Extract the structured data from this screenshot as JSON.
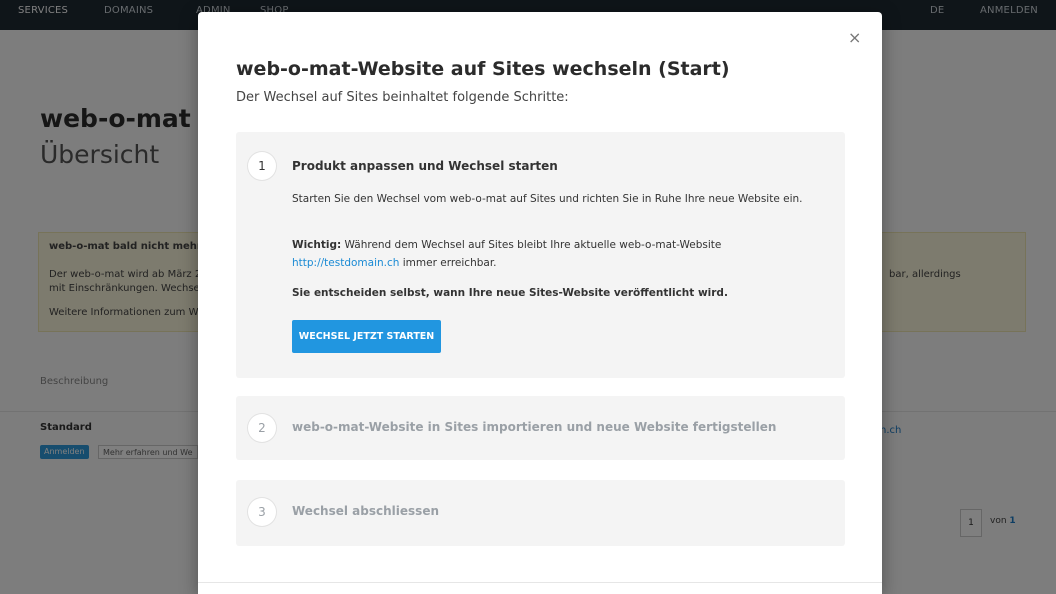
{
  "topbar": {
    "services": "SERVICES",
    "domains": "DOMAINS",
    "admin": "ADMIN",
    "shop": "SHOP",
    "user": "",
    "lang": "DE",
    "login": "Anmelden"
  },
  "page": {
    "title": "web-o-mat",
    "subtitle": "Übersicht",
    "notice_title": "web-o-mat bald nicht mehr",
    "notice_line1": "Der web-o-mat wird ab März 2",
    "notice_line2": "mit Einschränkungen. Wechse",
    "notice_line3": "Weitere Informationen zum W",
    "notice_right": "bar, allerdings",
    "beschreibung": "Beschreibung",
    "standard": "Standard",
    "anmelden_btn": "Anmelden",
    "mehr_btn": "Mehr erfahren und We",
    "domain_fragment": "n.ch",
    "pager_current": "1",
    "pager_von": "von",
    "pager_total": "1"
  },
  "modal": {
    "title": "web-o-mat-Website auf Sites wechseln (Start)",
    "subtitle": "Der Wechsel auf Sites beinhaltet folgende Schritte:",
    "close_label": "×",
    "step1": {
      "number": "1",
      "title": "Produkt anpassen und Wechsel starten",
      "para1": "Starten Sie den Wechsel vom web-o-mat auf Sites und richten Sie in Ruhe Ihre neue Website ein.",
      "para2_bold": "Wichtig:",
      "para2_text": " Während dem Wechsel auf Sites bleibt Ihre aktuelle web-o-mat-Website ",
      "para2_link": "http://testdomain.ch",
      "para2_end": " immer erreichbar.",
      "para3": "Sie entscheiden selbst, wann Ihre neue Sites-Website veröffentlicht wird.",
      "button": "WECHSEL JETZT STARTEN"
    },
    "step2": {
      "number": "2",
      "title": "web-o-mat-Website in Sites importieren und neue Website fertigstellen"
    },
    "step3": {
      "number": "3",
      "title": "Wechsel abschliessen"
    }
  }
}
